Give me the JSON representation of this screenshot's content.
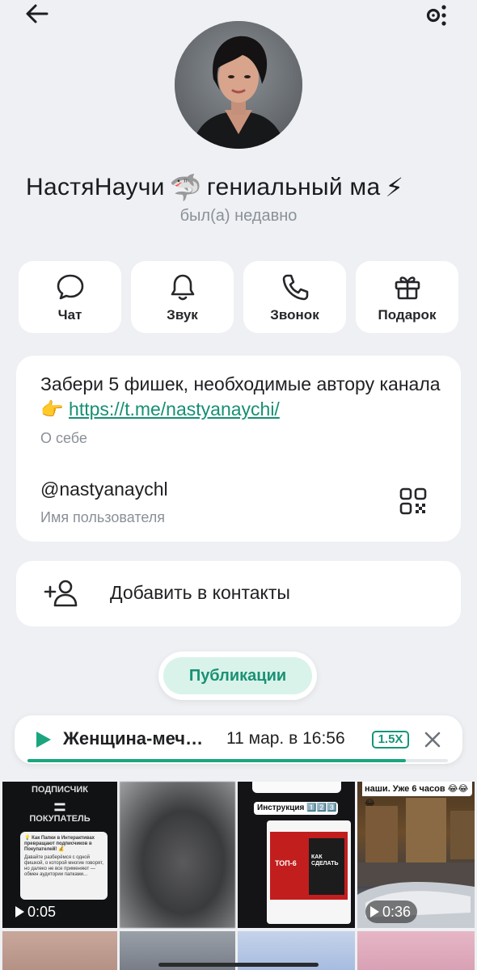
{
  "profile": {
    "name_part1": "НастяНаучи",
    "name_emoji1": "🦈",
    "name_part2": "гениальный ма",
    "name_emoji2": "⚡",
    "status": "был(а) недавно"
  },
  "actions": [
    {
      "label": "Чат",
      "icon": "chat-bubble-icon"
    },
    {
      "label": "Звук",
      "icon": "bell-icon"
    },
    {
      "label": "Звонок",
      "icon": "phone-icon"
    },
    {
      "label": "Подарок",
      "icon": "gift-icon"
    }
  ],
  "info": {
    "bio_text": "Забери 5 фишек, необходимые автору канала👉",
    "bio_link": "https://t.me/nastyanaychi/",
    "bio_caption": "О себе",
    "username": "@nastyanaychl",
    "username_caption": "Имя пользователя"
  },
  "add_contact": {
    "label": "Добавить в контакты"
  },
  "publications": {
    "label": "Публикации"
  },
  "player": {
    "title": "Женщина-меч…",
    "time": "11 мар. в 16:56",
    "speed": "1.5X",
    "progress": 0.9
  },
  "grid": {
    "tile1": {
      "top": "ПОДПИСЧИК",
      "eq": "=",
      "bottom": "ПОКУПАТЕЛЬ",
      "card_line1": "💡 Как Папки в Интерактивах превращают подписчиков в Покупателей! 💰",
      "card_line2": "Давайте разберёмся с одной фишкой, о которой многие говорят, но далеко не все применяют — обмен аудитории папками...",
      "duration": "0:05"
    },
    "tile3": {
      "header": "Инструкция 1️⃣2️⃣3️⃣",
      "red_label": "ТОП-6",
      "dark_label": "КАК СДЕЛАТЬ"
    },
    "tile4": {
      "caption": "наши. Уже 6 часов 😂😂😂",
      "duration": "0:36"
    }
  },
  "colors": {
    "accent": "#1a9174",
    "link": "#168f73",
    "background": "#eef0f3"
  }
}
